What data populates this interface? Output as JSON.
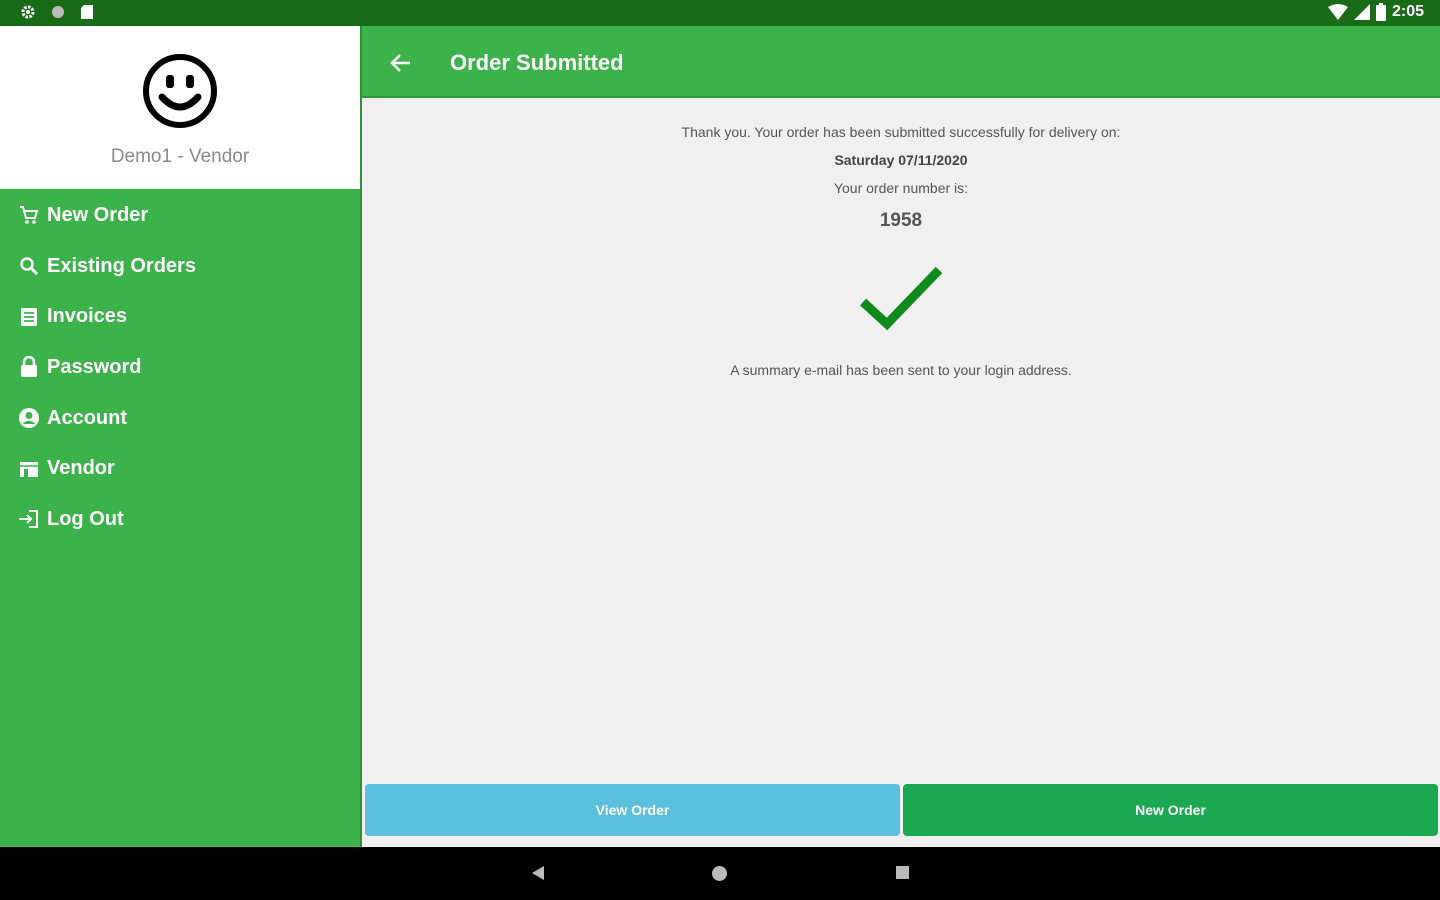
{
  "status_bar": {
    "time": "2:05"
  },
  "drawer": {
    "user_name": "Demo1 - Vendor",
    "items": [
      {
        "label": "New Order",
        "icon": "cart-icon"
      },
      {
        "label": "Existing Orders",
        "icon": "search-icon"
      },
      {
        "label": "Invoices",
        "icon": "invoice-icon"
      },
      {
        "label": "Password",
        "icon": "lock-icon"
      },
      {
        "label": "Account",
        "icon": "account-icon"
      },
      {
        "label": "Vendor",
        "icon": "store-icon"
      },
      {
        "label": "Log Out",
        "icon": "logout-icon"
      }
    ]
  },
  "appbar": {
    "title": "Order Submitted"
  },
  "confirmation": {
    "thank_you": "Thank you. Your order has been submitted successfully for delivery on:",
    "delivery_date": "Saturday 07/11/2020",
    "order_number_label": "Your order number is:",
    "order_number": "1958",
    "summary_note": "A summary e-mail has been sent to your login address."
  },
  "actions": {
    "view_order": "View Order",
    "new_order": "New Order"
  },
  "colors": {
    "primary": "#3bb24a",
    "status_bar": "#1a6b18",
    "view_button": "#5bc0de",
    "new_button": "#1aa851",
    "check": "#0f8a1c"
  }
}
